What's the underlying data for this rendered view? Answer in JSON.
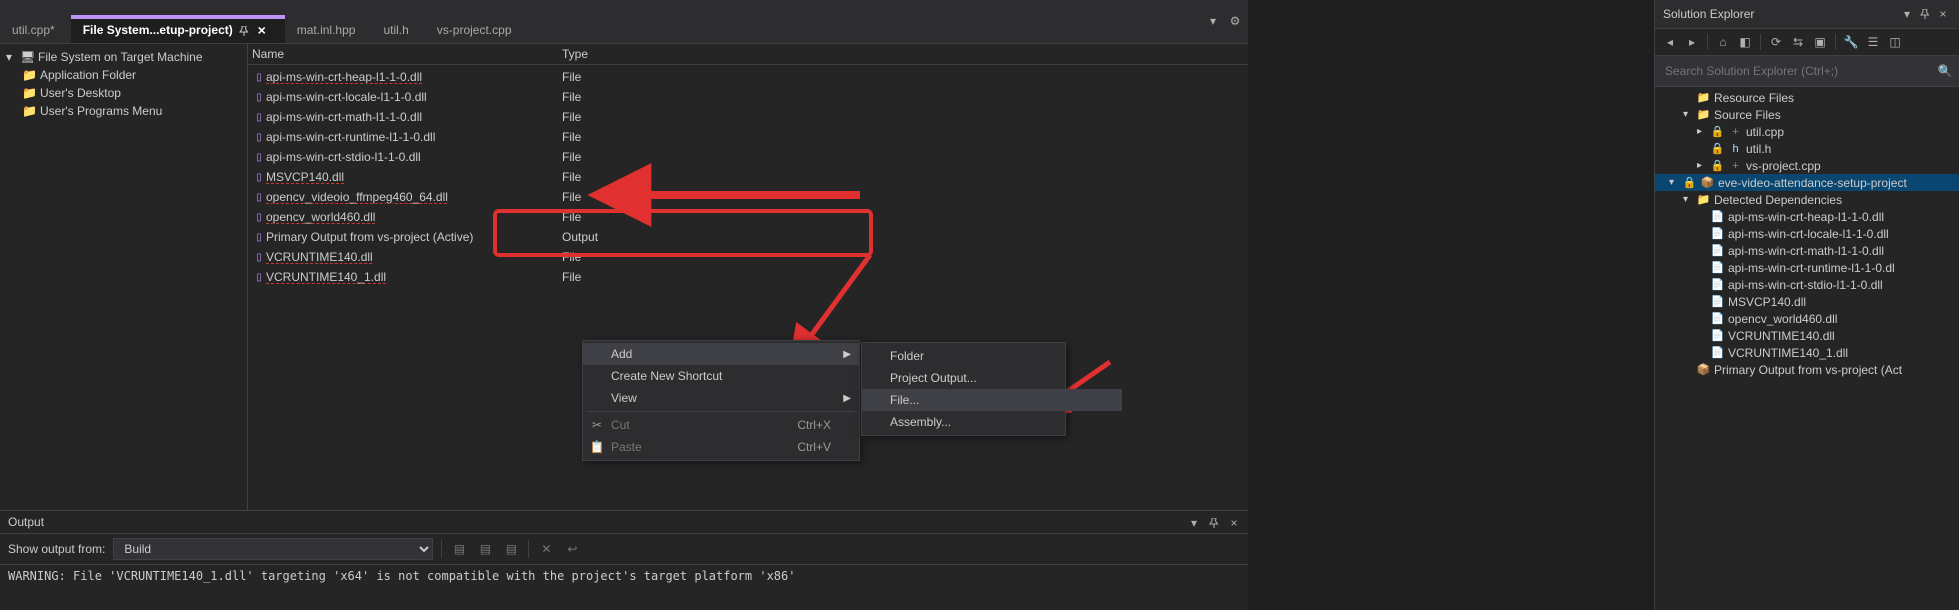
{
  "tabs": {
    "util_cpp_mod": "util.cpp*",
    "filesystem": "File System...etup-project)",
    "mat_inl": "mat.inl.hpp",
    "util_h": "util.h",
    "vs_project": "vs-project.cpp"
  },
  "fs_tree": {
    "root": "File System on Target Machine",
    "app_folder": "Application Folder",
    "desktop": "User's Desktop",
    "programs": "User's Programs Menu"
  },
  "fs_headers": {
    "name": "Name",
    "type": "Type"
  },
  "fs_items": [
    {
      "name": "api-ms-win-crt-heap-l1-1-0.dll",
      "type": "File"
    },
    {
      "name": "api-ms-win-crt-locale-l1-1-0.dll",
      "type": "File"
    },
    {
      "name": "api-ms-win-crt-math-l1-1-0.dll",
      "type": "File"
    },
    {
      "name": "api-ms-win-crt-runtime-l1-1-0.dll",
      "type": "File"
    },
    {
      "name": "api-ms-win-crt-stdio-l1-1-0.dll",
      "type": "File"
    },
    {
      "name": "MSVCP140.dll",
      "type": "File"
    },
    {
      "name": "opencv_videoio_ffmpeg460_64.dll",
      "type": "File"
    },
    {
      "name": "opencv_world460.dll",
      "type": "File"
    },
    {
      "name": "Primary Output from vs-project (Active)",
      "type": "Output"
    },
    {
      "name": "VCRUNTIME140.dll",
      "type": "File"
    },
    {
      "name": "VCRUNTIME140_1.dll",
      "type": "File"
    }
  ],
  "context_main": {
    "add": "Add",
    "new_shortcut": "Create New Shortcut",
    "view": "View",
    "cut": "Cut",
    "paste": "Paste",
    "cut_sc": "Ctrl+X",
    "paste_sc": "Ctrl+V"
  },
  "context_sub": {
    "folder": "Folder",
    "project_output": "Project Output...",
    "file": "File...",
    "assembly": "Assembly..."
  },
  "output": {
    "title": "Output",
    "show_from": "Show output from:",
    "source": "Build",
    "body": "WARNING: File 'VCRUNTIME140_1.dll' targeting 'x64' is not compatible with the project's target platform 'x86'"
  },
  "solution_explorer": {
    "title": "Solution Explorer",
    "search_placeholder": "Search Solution Explorer (Ctrl+;)",
    "nodes": {
      "resource_files": "Resource Files",
      "source_files": "Source Files",
      "util_cpp": "util.cpp",
      "util_h": "util.h",
      "vs_project_cpp": "vs-project.cpp",
      "setup_project": "eve-video-attendance-setup-project",
      "detected_deps": "Detected Dependencies",
      "dep1": "api-ms-win-crt-heap-l1-1-0.dll",
      "dep2": "api-ms-win-crt-locale-l1-1-0.dll",
      "dep3": "api-ms-win-crt-math-l1-1-0.dll",
      "dep4": "api-ms-win-crt-runtime-l1-1-0.dl",
      "dep5": "api-ms-win-crt-stdio-l1-1-0.dll",
      "dep6": "MSVCP140.dll",
      "dep7": "opencv_world460.dll",
      "dep8": "VCRUNTIME140.dll",
      "dep9": "VCRUNTIME140_1.dll",
      "primary": "Primary Output from vs-project (Act"
    }
  }
}
